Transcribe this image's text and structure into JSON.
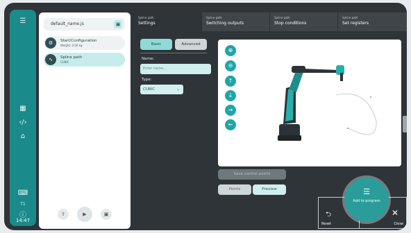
{
  "rail": {
    "time": "14:47",
    "t1": "T1",
    "icons": [
      "menu-icon",
      "grid-icon",
      "code-icon",
      "home-icon",
      "terminal-icon",
      "info-icon"
    ]
  },
  "left_panel": {
    "file_name": "default_name.js",
    "nodes": [
      {
        "title": "Start/Configuration",
        "subtitle": "Weight: 0.00 kg",
        "icon": "gear-icon"
      },
      {
        "title": "Spline path",
        "subtitle": "CUBIC",
        "icon": "spline-icon"
      }
    ],
    "bottom_buttons": [
      "upload-icon",
      "play-icon",
      "save-icon"
    ]
  },
  "tabs": [
    {
      "top": "Spline path",
      "bottom": "Settings"
    },
    {
      "top": "Spline path",
      "bottom": "Switching outputs"
    },
    {
      "top": "Spline path",
      "bottom": "Stop conditions"
    },
    {
      "top": "Spline path",
      "bottom": "Set registers"
    }
  ],
  "settings": {
    "basic_label": "Basic",
    "advanced_label": "Advanced",
    "name_label": "Name:",
    "name_placeholder": "Enter name...",
    "type_label": "Type:",
    "type_value": "CUBIC"
  },
  "viewport": {
    "controls": [
      "zoom-in-icon",
      "zoom-out-icon",
      "arrow-up-icon",
      "arrow-down-icon",
      "arrow-right-icon",
      "arrow-left-icon"
    ]
  },
  "bottom_controls": {
    "save_points": "Save control points",
    "points": "Points",
    "preview": "Preview"
  },
  "actions": {
    "add_label": "Add to program",
    "reset_label": "Reset",
    "close_label": "Close"
  },
  "colors": {
    "accent": "#20a6a6",
    "rail": "#1a8a8a",
    "dark_bg": "#2e3438"
  }
}
